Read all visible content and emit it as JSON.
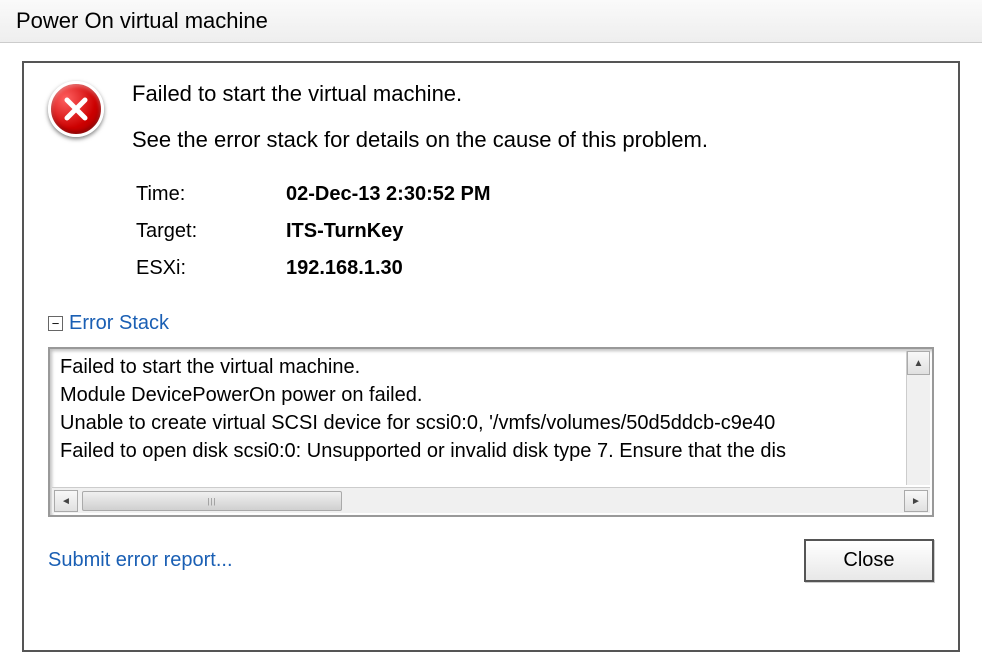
{
  "title": "Power On virtual machine",
  "message": {
    "heading": "Failed to start the virtual machine.",
    "subtext": "See the error stack for details on the cause of this problem."
  },
  "details": {
    "time_label": "Time:",
    "time_value": "02-Dec-13 2:30:52 PM",
    "target_label": "Target:",
    "target_value": "ITS-TurnKey",
    "esxi_label": "ESXi:",
    "esxi_value": "192.168.1.30"
  },
  "error_stack": {
    "toggle_glyph": "−",
    "label": "Error Stack",
    "lines": [
      "Failed to start the virtual machine.",
      "Module DevicePowerOn power on failed.",
      "Unable to create virtual SCSI device for scsi0:0, '/vmfs/volumes/50d5ddcb-c9e40",
      "Failed to open disk scsi0:0: Unsupported or invalid disk type 7. Ensure that the dis"
    ]
  },
  "footer": {
    "submit_link": "Submit error report...",
    "close_label": "Close"
  }
}
